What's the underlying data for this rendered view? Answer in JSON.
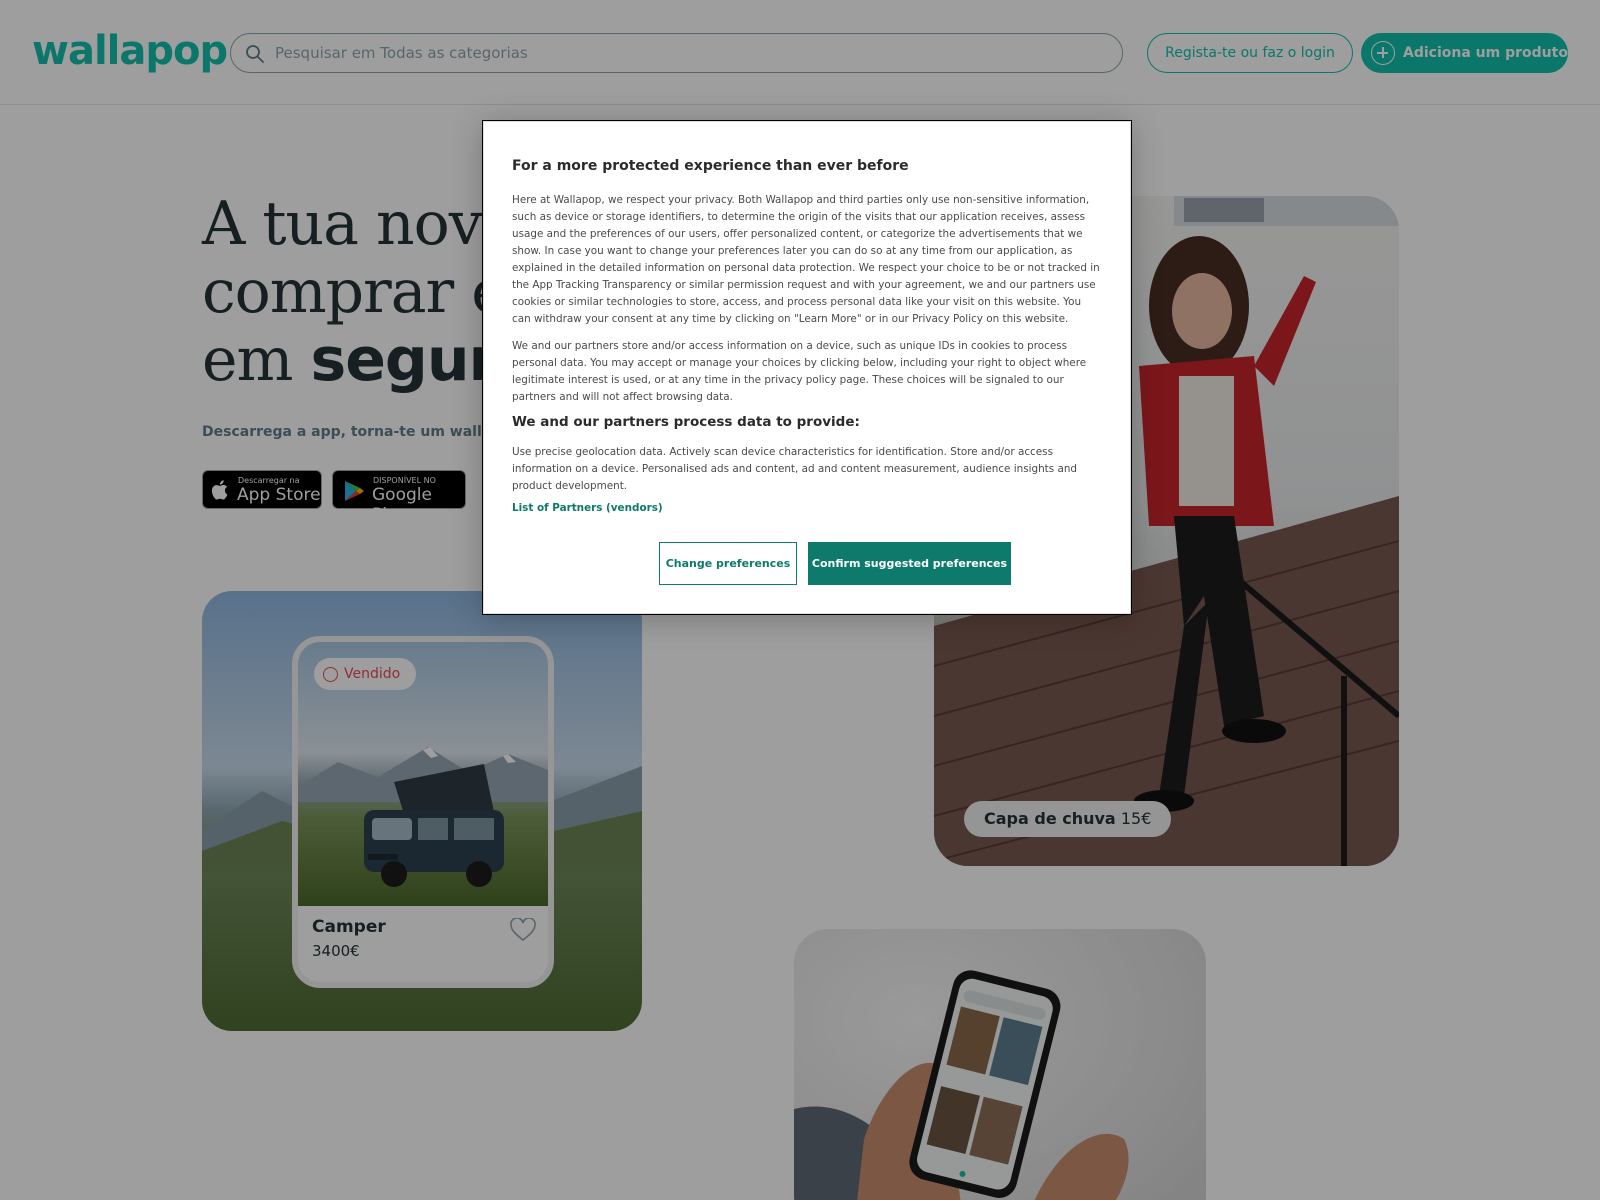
{
  "header": {
    "logo_text": "wallapop",
    "search_placeholder": "Pesquisar em Todas as categorias",
    "login_label": "Regista-te ou faz o login",
    "add_product_label": "Adiciona um produto"
  },
  "hero": {
    "title_line1": "A tua nova p",
    "title_line2": "comprar e v",
    "title_line3_prefix": "em ",
    "title_line3_bold": "segund",
    "subtitle": "Descarrega a app, torna-te um wallapope",
    "appstore_small": "Descarregar na",
    "appstore_big": "App Store",
    "playstore_small": "DISPONÍVEL NO",
    "playstore_big": "Google Play"
  },
  "cards": {
    "camper": {
      "badge": "Vendido",
      "title": "Camper",
      "price": "3400€"
    },
    "raincoat": {
      "name": "Capa de chuva",
      "price": "15€"
    }
  },
  "consent": {
    "title": "For a more protected experience than ever before",
    "paragraph1": "Here at Wallapop, we respect your privacy. Both Wallapop and third parties only use non-sensitive information, such as device or storage identifiers, to determine the origin of the visits that our application receives, assess usage and the preferences of our users, offer personalized content, or categorize the advertisements that we show. In case you want to change your preferences later you can do so at any time from our application, as explained in the detailed information on personal data protection. We respect your choice to be or not tracked in the App Tracking Transparency or similar permission request and with your agreement, we and our partners use cookies or similar technologies to store, access, and process personal data like your visit on this website. You can withdraw your consent at any time by clicking on \"Learn More\" or in our Privacy Policy on this website.",
    "paragraph2": "We and our partners store and/or access information on a device, such as unique IDs in cookies to process personal data. You may accept or manage your choices by clicking below, including your right to object where legitimate interest is used, or at any time in the privacy policy page. These choices will be signaled to our partners and will not affect browsing data.",
    "subheading": "We and our partners process data to provide:",
    "paragraph3": "Use precise geolocation data. Actively scan device characteristics for identification. Store and/or access information on a device. Personalised ads and content, ad and content measurement, audience insights and product development.",
    "partners_link": "List of Partners (vendors)",
    "change_label": "Change preferences",
    "confirm_label": "Confirm suggested preferences"
  },
  "colors": {
    "brand": "#13c1ac",
    "consent_accent": "#0d7a6c",
    "sold": "#e8495a"
  }
}
